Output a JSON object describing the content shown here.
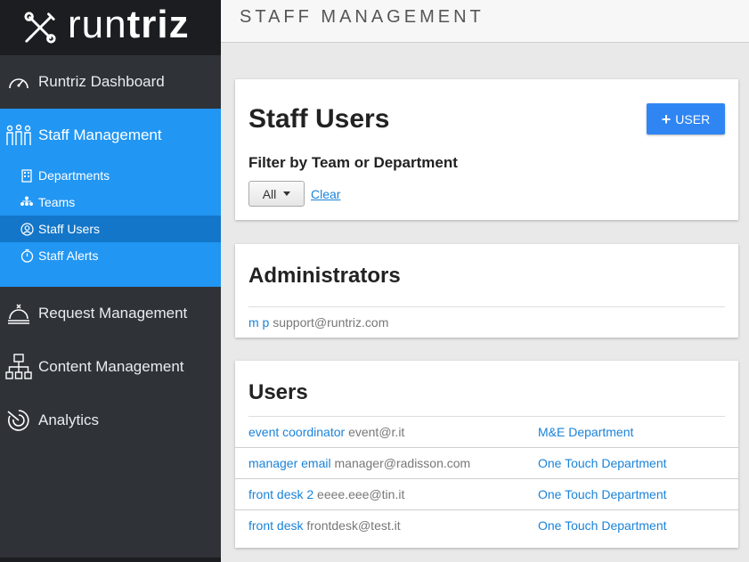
{
  "app": {
    "logo_light": "run",
    "logo_bold": "triz"
  },
  "sidebar": {
    "items": [
      {
        "label": "Runtriz Dashboard",
        "icon": "speedometer-icon"
      },
      {
        "label": "Staff Management",
        "icon": "people-group-icon"
      },
      {
        "label": "Request Management",
        "icon": "service-bell-icon"
      },
      {
        "label": "Content Management",
        "icon": "sitemap-icon"
      },
      {
        "label": "Analytics",
        "icon": "analytics-icon"
      }
    ],
    "sub_items": [
      {
        "label": "Departments",
        "icon": "building-icon"
      },
      {
        "label": "Teams",
        "icon": "team-hierarchy-icon"
      },
      {
        "label": "Staff Users",
        "icon": "user-circle-icon"
      },
      {
        "label": "Staff Alerts",
        "icon": "stopwatch-icon"
      }
    ]
  },
  "header": {
    "title": "STAFF MANAGEMENT"
  },
  "staff_card": {
    "title": "Staff Users",
    "add_button": "USER",
    "filter_label": "Filter by Team or Department",
    "filter_value": "All",
    "clear_label": "Clear"
  },
  "admins_card": {
    "title": "Administrators",
    "admins": [
      {
        "name": "m p",
        "email": "support@runtriz.com"
      }
    ]
  },
  "users_card": {
    "title": "Users",
    "users": [
      {
        "name": "event coordinator",
        "email": "event@r.it",
        "department": "M&E Department"
      },
      {
        "name": "manager email",
        "email": "manager@radisson.com",
        "department": "One Touch Department"
      },
      {
        "name": "front desk 2",
        "email": "eeee.eee@tin.it",
        "department": "One Touch Department"
      },
      {
        "name": "front desk",
        "email": "frontdesk@test.it",
        "department": "One Touch Department"
      }
    ]
  },
  "colors": {
    "accent": "#2196f3",
    "selected": "#1376c9",
    "sidebar_bg": "#2f3338",
    "link": "#1a83d9"
  }
}
